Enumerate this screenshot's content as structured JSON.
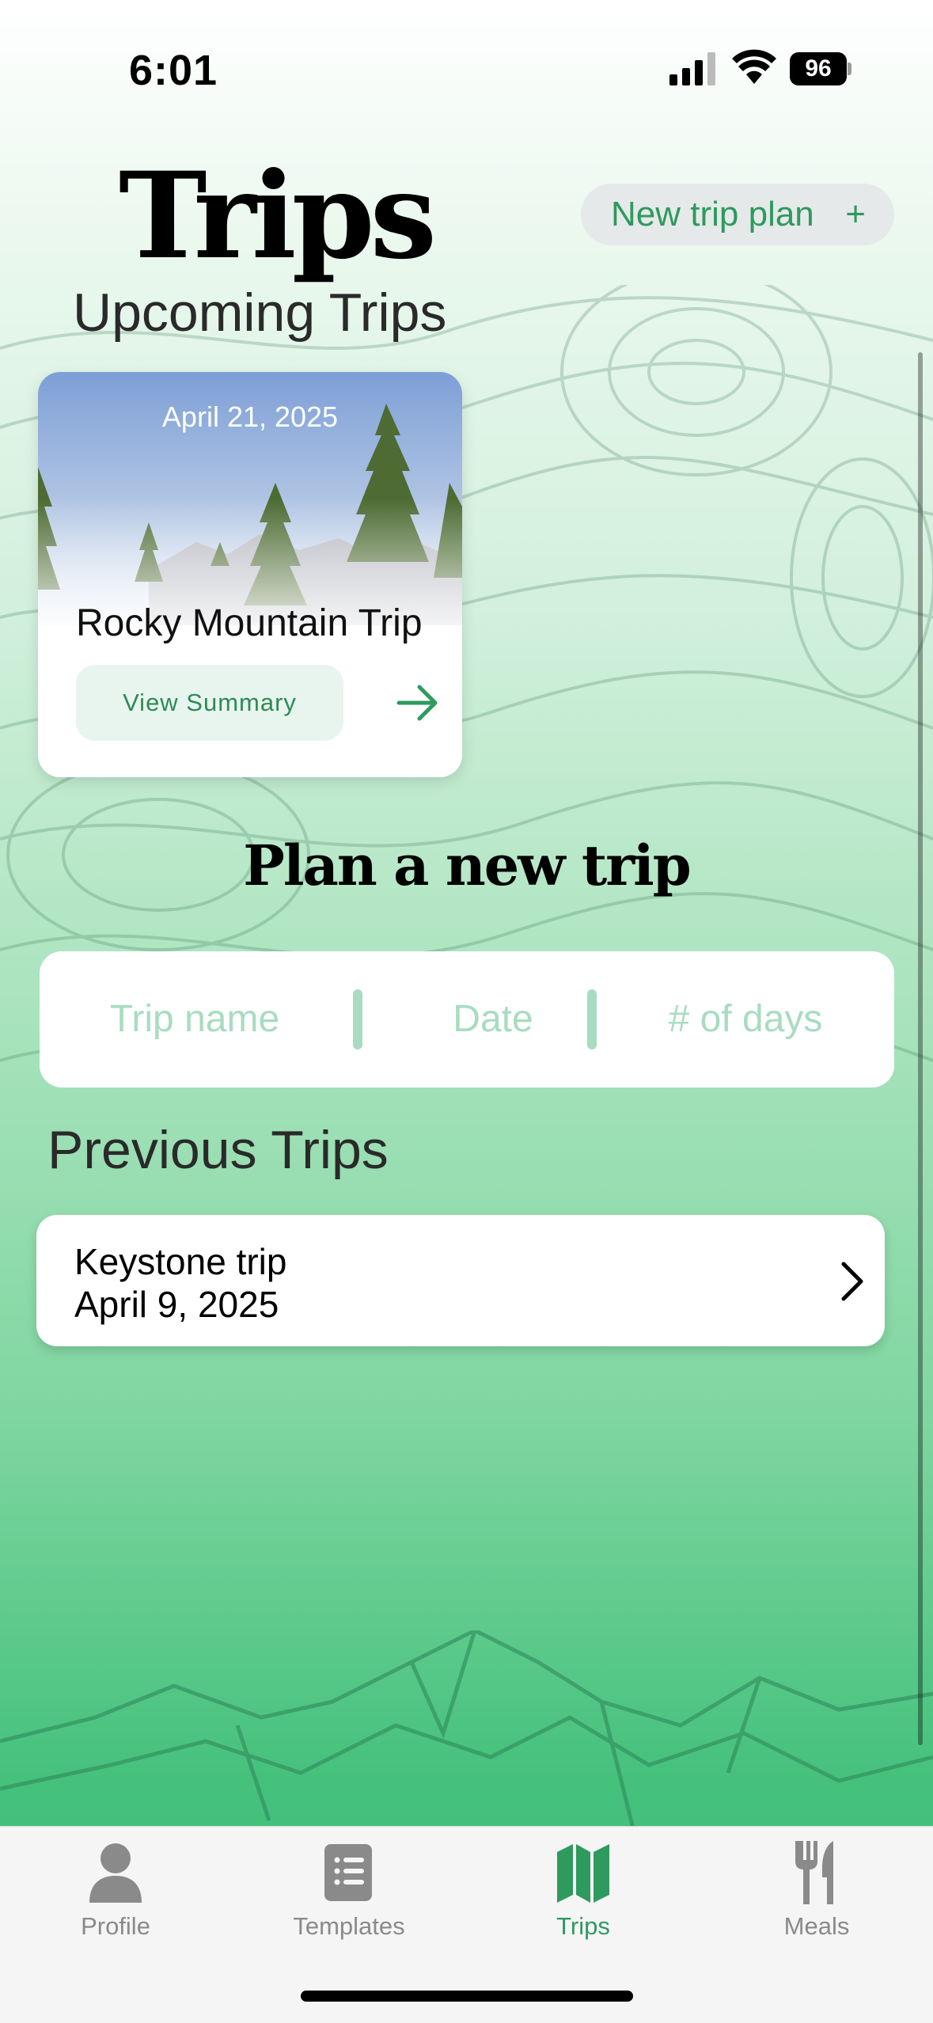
{
  "status_bar": {
    "time": "6:01",
    "battery": "96"
  },
  "header": {
    "title": "Trips",
    "new_trip_label": "New trip plan",
    "new_trip_icon": "+"
  },
  "upcoming": {
    "heading": "Upcoming Trips",
    "card": {
      "date": "April 21, 2025",
      "name": "Rocky Mountain Trip",
      "button": "View Summary"
    }
  },
  "plan": {
    "heading": "Plan a new trip",
    "fields": {
      "name_placeholder": "Trip name",
      "date_placeholder": "Date",
      "days_placeholder": "# of days"
    }
  },
  "previous": {
    "heading": "Previous Trips",
    "items": [
      {
        "name": "Keystone trip",
        "date": "April 9, 2025"
      }
    ]
  },
  "tabs": [
    {
      "label": "Profile",
      "icon": "person-icon"
    },
    {
      "label": "Templates",
      "icon": "list-icon"
    },
    {
      "label": "Trips",
      "icon": "map-icon",
      "active": true
    },
    {
      "label": "Meals",
      "icon": "fork-knife-icon"
    }
  ],
  "colors": {
    "accent": "#2e9a5e",
    "placeholder": "#a8dcc0",
    "tab_inactive": "#8a8a8a"
  }
}
